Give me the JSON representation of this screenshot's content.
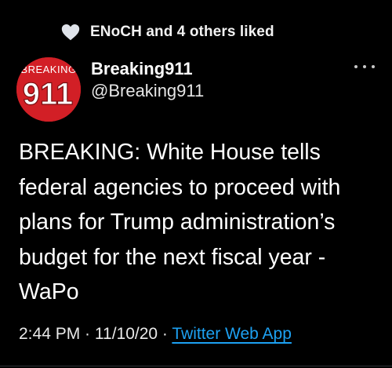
{
  "social_context": {
    "text": "ENoCH and 4 others liked",
    "icon": "heart-icon"
  },
  "tweet": {
    "author": {
      "display_name": "Breaking911",
      "handle": "@Breaking911",
      "avatar_top_text": "BREAKING",
      "avatar_main_text": "911"
    },
    "more_icon": "more-horizontal-icon",
    "text": "BREAKING: White House tells\nfederal agencies to proceed with\nplans for Trump administration’s\nbudget for the next fiscal year -\nWaPo",
    "time": "2:44 PM",
    "separator_1": " · ",
    "date": "11/10/20",
    "separator_2": " · ",
    "source": "Twitter Web App"
  },
  "colors": {
    "background": "#000000",
    "link": "#1da1f2",
    "avatar_bg": "#d21f26"
  }
}
